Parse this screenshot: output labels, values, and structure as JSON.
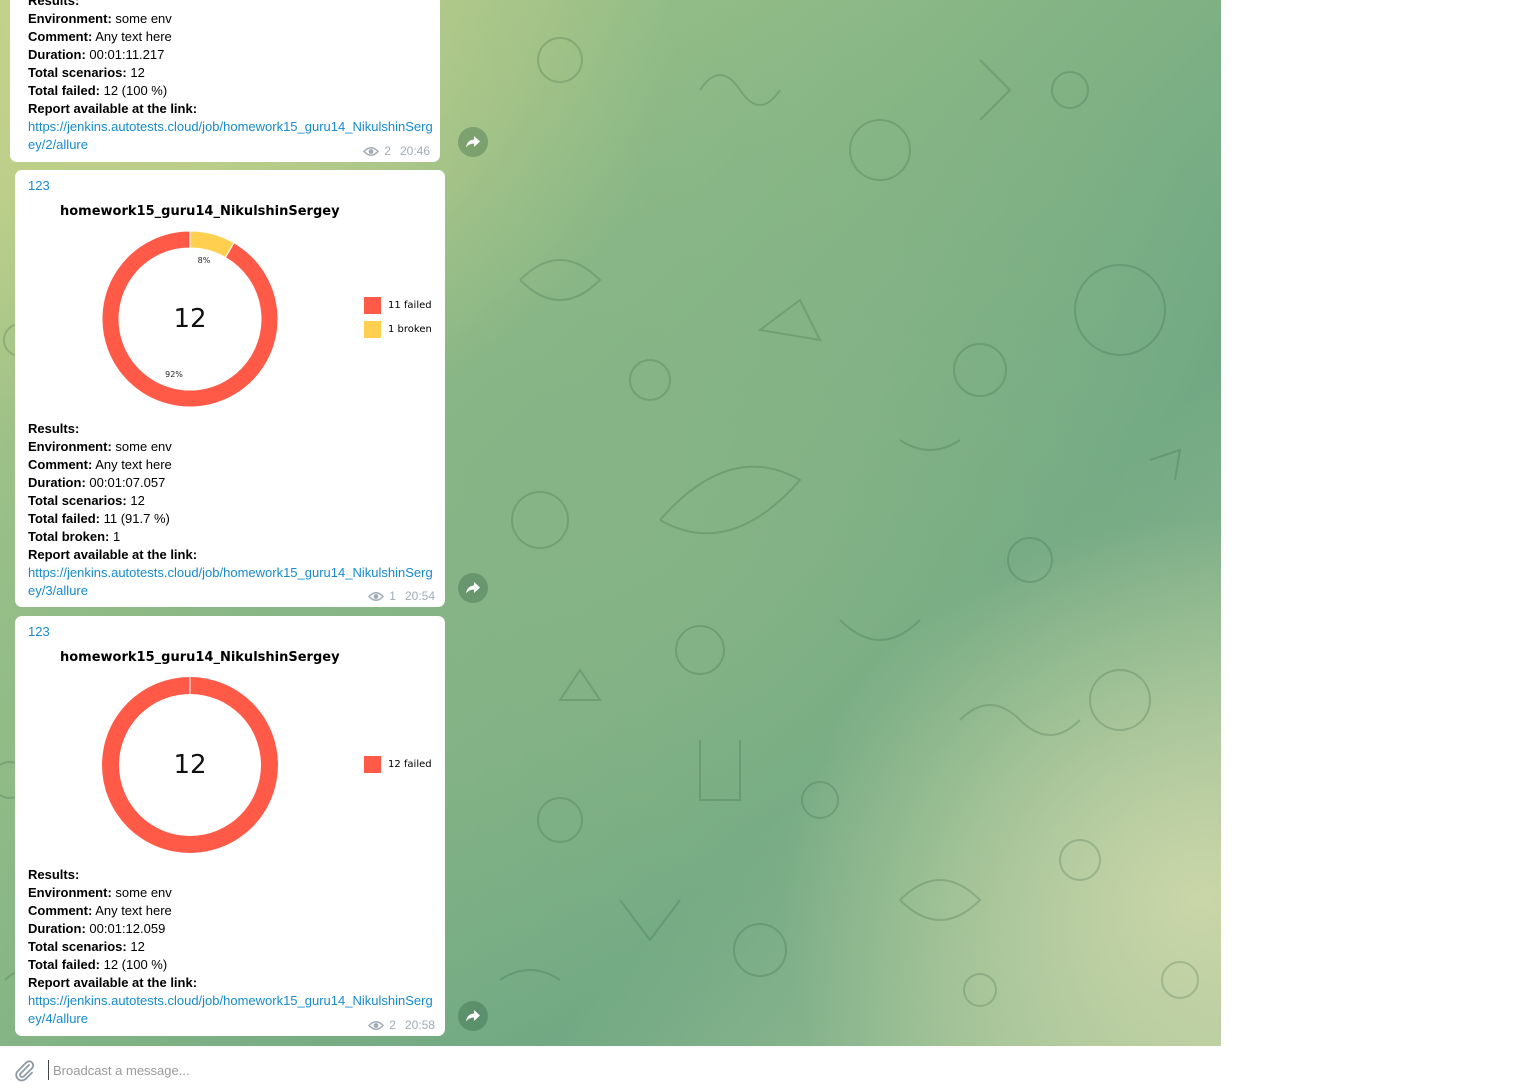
{
  "composer": {
    "placeholder": "Broadcast a message..."
  },
  "colors": {
    "failed": "#ff5a48",
    "broken": "#ffd050",
    "link": "#168acd"
  },
  "messages": [
    {
      "results_label": "Results:",
      "environment_label": "Environment:",
      "environment": "some env",
      "comment_label": "Comment:",
      "comment": "Any text here",
      "duration_label": "Duration:",
      "duration": "00:01:11.217",
      "scenarios_label": "Total scenarios:",
      "scenarios": "12",
      "failed_label": "Total failed:",
      "failed": "12 (100 %)",
      "report_label": "Report available at the link:",
      "link": "https://jenkins.autotests.cloud/job/homework15_guru14_NikulshinSergey/2/allure",
      "views": "2",
      "time": "20:46"
    },
    {
      "sender": "123",
      "chart_title": "homework15_guru14_NikulshinSergey",
      "total": "12",
      "pct_broken": "8%",
      "pct_failed": "92%",
      "legend_failed": "11 failed",
      "legend_broken": "1 broken",
      "results_label": "Results:",
      "environment_label": "Environment:",
      "environment": "some env",
      "comment_label": "Comment:",
      "comment": "Any text here",
      "duration_label": "Duration:",
      "duration": "00:01:07.057",
      "scenarios_label": "Total scenarios:",
      "scenarios": "12",
      "failed_label": "Total failed:",
      "failed": "11 (91.7 %)",
      "broken_label": "Total broken:",
      "broken": "1",
      "report_label": "Report available at the link:",
      "link": "https://jenkins.autotests.cloud/job/homework15_guru14_NikulshinSergey/3/allure",
      "views": "1",
      "time": "20:54"
    },
    {
      "sender": "123",
      "chart_title": "homework15_guru14_NikulshinSergey",
      "total": "12",
      "legend_failed": "12 failed",
      "results_label": "Results:",
      "environment_label": "Environment:",
      "environment": "some env",
      "comment_label": "Comment:",
      "comment": "Any text here",
      "duration_label": "Duration:",
      "duration": "00:01:12.059",
      "scenarios_label": "Total scenarios:",
      "scenarios": "12",
      "failed_label": "Total failed:",
      "failed": "12 (100 %)",
      "report_label": "Report available at the link:",
      "link": "https://jenkins.autotests.cloud/job/homework15_guru14_NikulshinSergey/4/allure",
      "views": "2",
      "time": "20:58"
    }
  ],
  "chart_data": [
    {
      "type": "pie",
      "title": "homework15_guru14_NikulshinSergey",
      "categories": [
        "11 failed",
        "1 broken"
      ],
      "values": [
        11,
        1
      ],
      "colors": [
        "#ff5a48",
        "#ffd050"
      ],
      "center_label": "12",
      "slice_labels": [
        "92%",
        "8%"
      ]
    },
    {
      "type": "pie",
      "title": "homework15_guru14_NikulshinSergey",
      "categories": [
        "12 failed"
      ],
      "values": [
        12
      ],
      "colors": [
        "#ff5a48"
      ],
      "center_label": "12"
    }
  ]
}
